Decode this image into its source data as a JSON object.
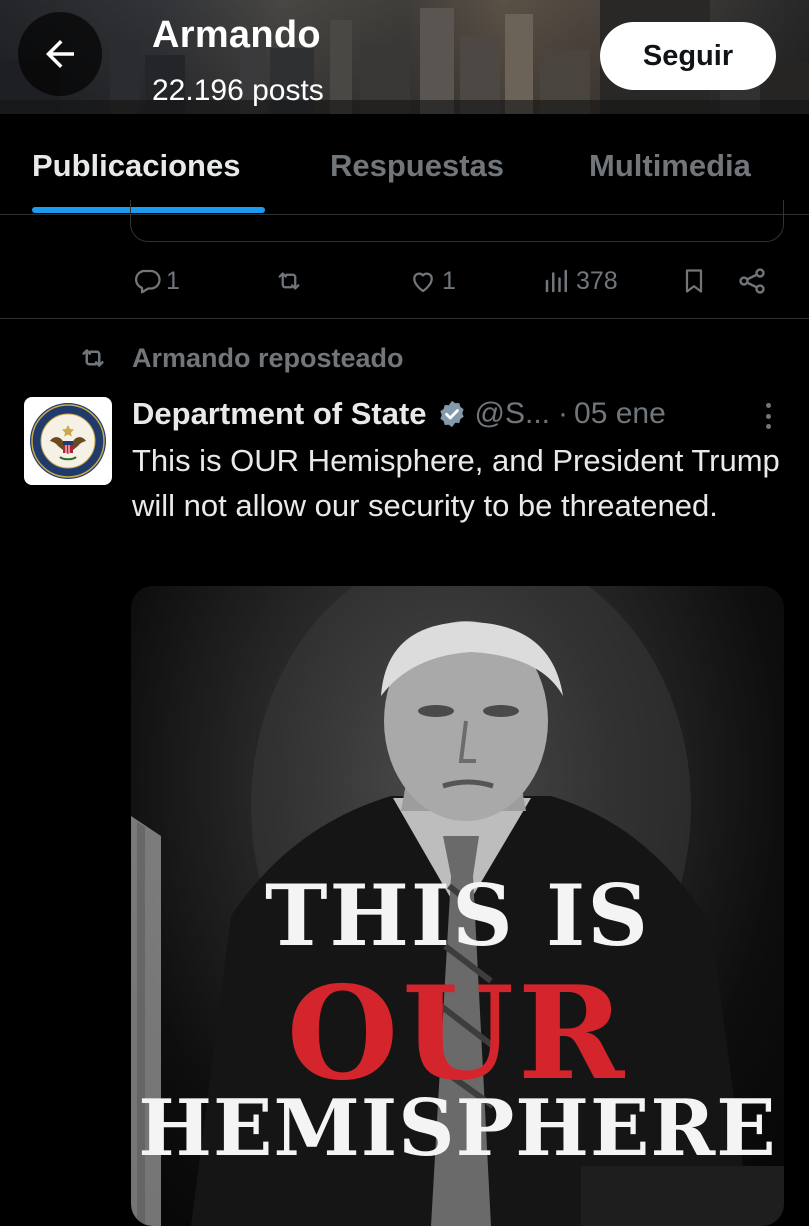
{
  "header": {
    "name": "Armando",
    "posts": "22.196 posts",
    "follow_label": "Seguir"
  },
  "tabs": [
    {
      "label": "Publicaciones",
      "active": true
    },
    {
      "label": "Respuestas",
      "active": false
    },
    {
      "label": "Multimedia",
      "active": false
    }
  ],
  "prev_tweet_actions": {
    "replies": "1",
    "likes": "1",
    "views": "378"
  },
  "repost": {
    "label": "Armando reposteado"
  },
  "tweet": {
    "author_name": "Department of State",
    "handle": "@S...",
    "separator": "·",
    "date": "05 ene",
    "text": "This is OUR Hemisphere, and President Trump will not allow our security to be threatened.",
    "media_text": {
      "line1": "THIS IS",
      "line2": "OUR",
      "line3": "HEMISPHERE"
    }
  },
  "colors": {
    "accent": "#1d9bf0",
    "muted": "#71767b",
    "text": "#e7e9ea",
    "media_red": "#d4242c"
  }
}
